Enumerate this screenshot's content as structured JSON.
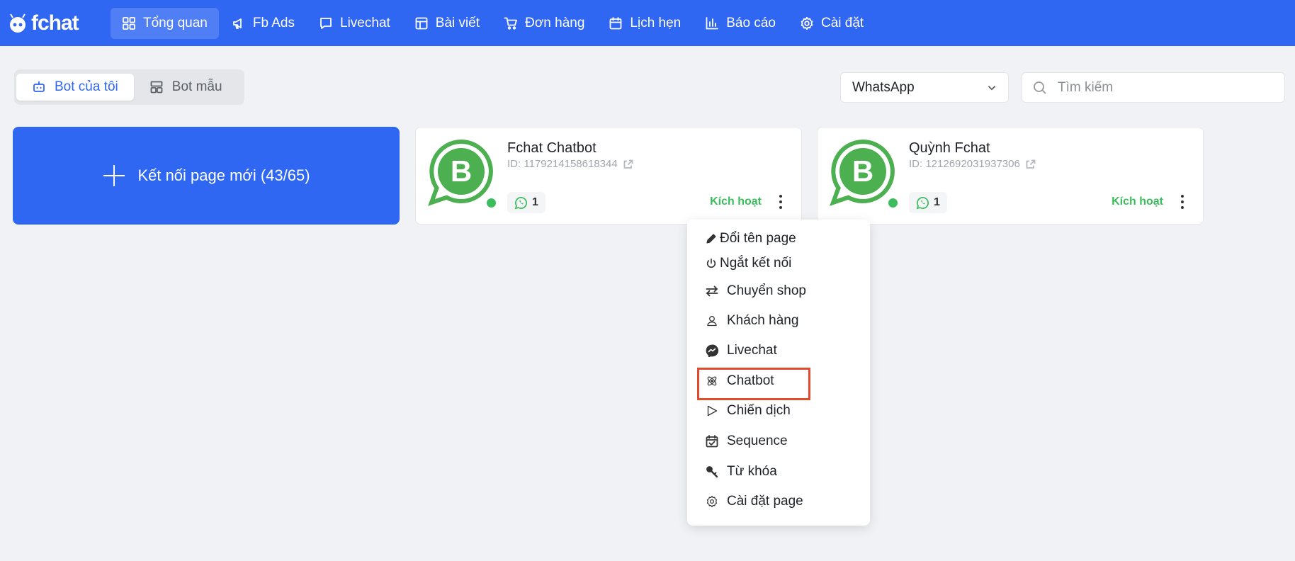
{
  "app": {
    "logo": "fchat"
  },
  "nav": [
    {
      "label": "Tổng quan",
      "icon": "grid-icon",
      "active": true
    },
    {
      "label": "Fb Ads",
      "icon": "megaphone-icon"
    },
    {
      "label": "Livechat",
      "icon": "chat-bubble-icon"
    },
    {
      "label": "Bài viết",
      "icon": "layout-icon"
    },
    {
      "label": "Đơn hàng",
      "icon": "cart-icon"
    },
    {
      "label": "Lịch hẹn",
      "icon": "calendar-icon"
    },
    {
      "label": "Báo cáo",
      "icon": "bar-chart-icon"
    },
    {
      "label": "Cài đặt",
      "icon": "gear-icon"
    }
  ],
  "tabs": [
    {
      "label": "Bot của tôi",
      "icon": "robot-icon",
      "active": true
    },
    {
      "label": "Bot mẫu",
      "icon": "template-icon"
    }
  ],
  "platform_select": {
    "value": "WhatsApp"
  },
  "search": {
    "placeholder": "Tìm kiếm"
  },
  "connect_card": {
    "label": "Kết nối page mới (43/65)"
  },
  "cards": [
    {
      "name": "Fchat Chatbot",
      "id": "ID: 1179214158618344",
      "count": "1",
      "status": "Kích hoạt"
    },
    {
      "name": "Quỳnh Fchat",
      "id": "ID: 1212692031937306",
      "count": "1",
      "status": "Kích hoạt"
    }
  ],
  "colors": {
    "primary": "#2f66f2",
    "success": "#3bbd5d",
    "highlight": "#e04b30",
    "whatsapp": "#4caf50"
  },
  "menu": [
    {
      "label": "Đổi tên page",
      "icon": "pencil-icon"
    },
    {
      "label": "Ngắt kết nối",
      "icon": "power-icon"
    },
    {
      "label": "Chuyển shop",
      "icon": "swap-icon"
    },
    {
      "label": "Khách hàng",
      "icon": "user-icon"
    },
    {
      "label": "Livechat",
      "icon": "messenger-icon"
    },
    {
      "label": "Chatbot",
      "icon": "atom-icon",
      "highlighted": true
    },
    {
      "label": "Chiến dịch",
      "icon": "play-icon"
    },
    {
      "label": "Sequence",
      "icon": "calendar-check-icon"
    },
    {
      "label": "Từ khóa",
      "icon": "key-icon"
    },
    {
      "label": "Cài đặt page",
      "icon": "gear-icon"
    }
  ]
}
